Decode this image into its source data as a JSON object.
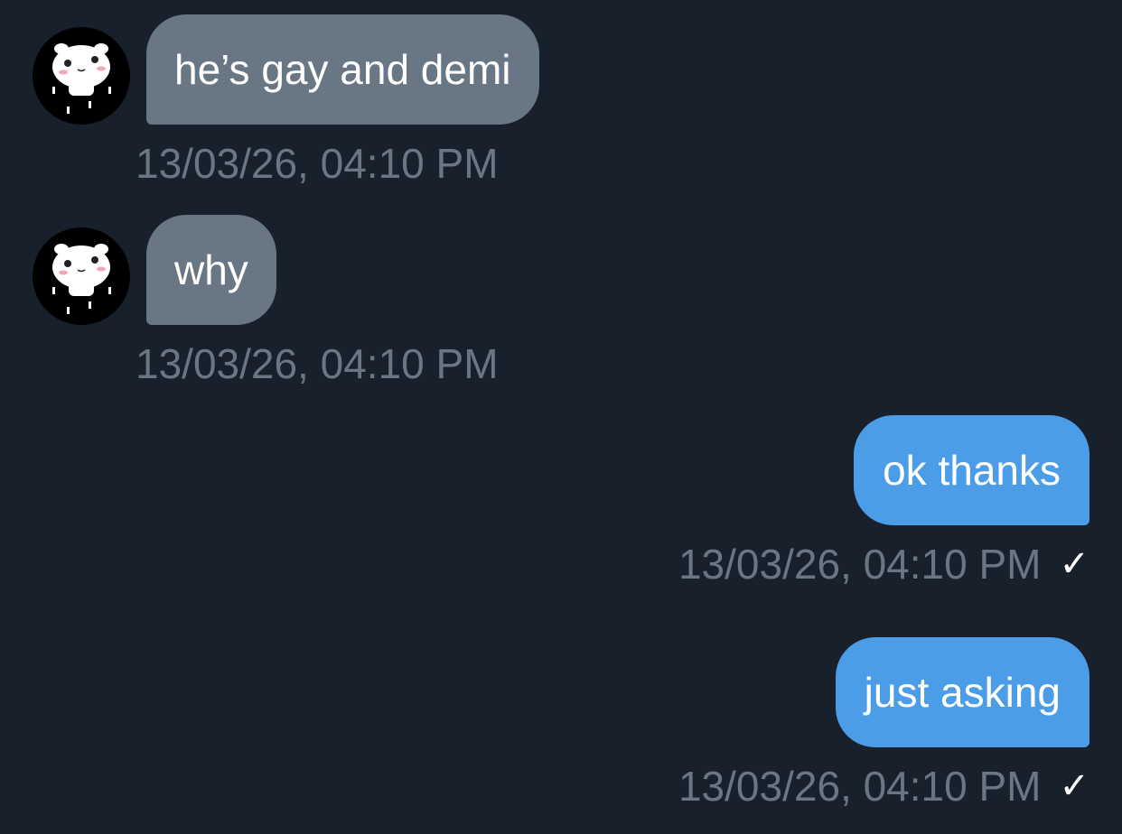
{
  "colors": {
    "background": "#18202b",
    "incoming_bubble": "#697785",
    "outgoing_bubble": "#4c9de8",
    "timestamp": "#697785",
    "text": "#ffffff"
  },
  "messages": [
    {
      "direction": "incoming",
      "text": "he’s gay and demi",
      "timestamp": "13/03/26, 04:10 PM",
      "avatar": "hamster-sticker-avatar"
    },
    {
      "direction": "incoming",
      "text": "why",
      "timestamp": "13/03/26, 04:10 PM",
      "avatar": "hamster-sticker-avatar"
    },
    {
      "direction": "outgoing",
      "text": "ok thanks",
      "timestamp": "13/03/26, 04:10 PM",
      "status_icon": "check-icon",
      "status_glyph": "✓"
    },
    {
      "direction": "outgoing",
      "text": "just asking",
      "timestamp": "13/03/26, 04:10 PM",
      "status_icon": "check-icon",
      "status_glyph": "✓"
    }
  ]
}
